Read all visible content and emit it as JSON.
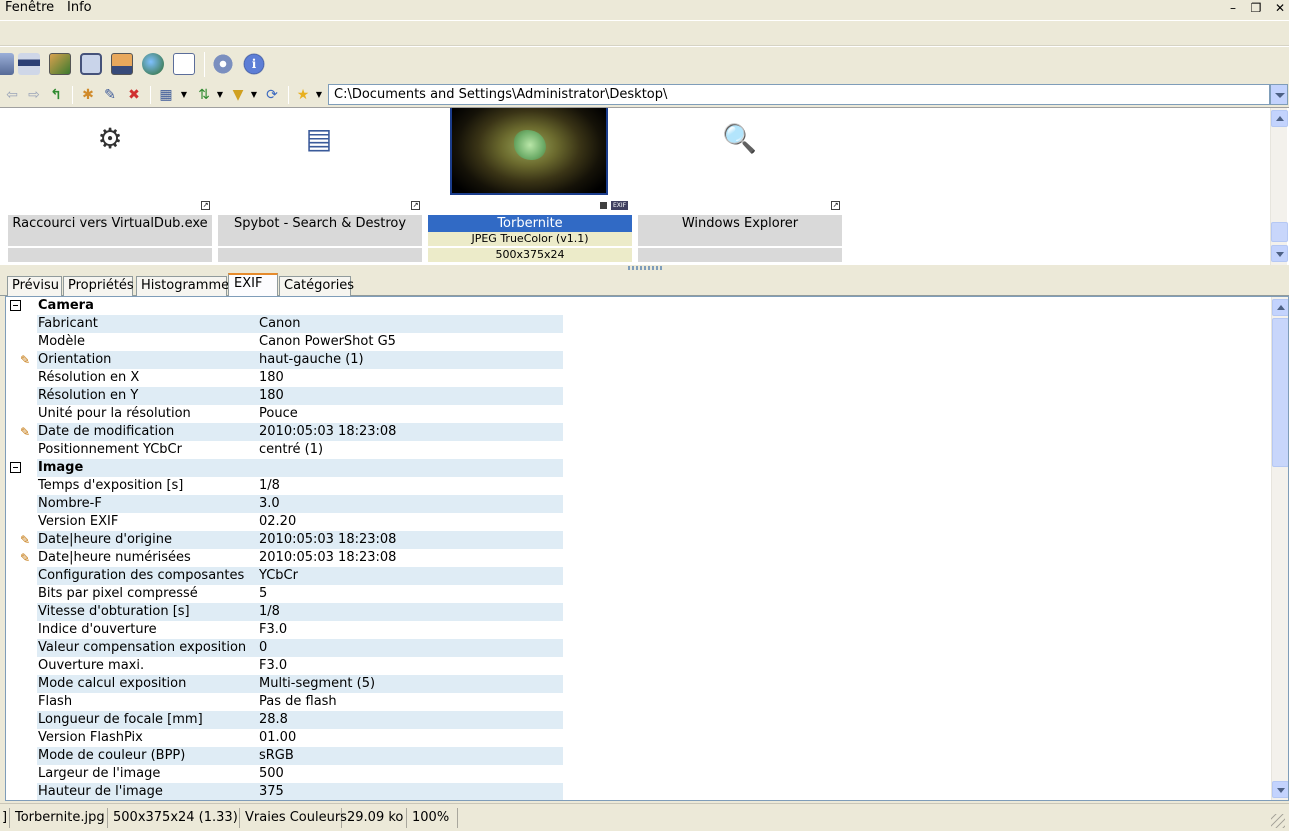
{
  "menu": {
    "items": [
      "Fenêtre",
      "Info"
    ]
  },
  "window_controls": {
    "minimize": "–",
    "restore": "❐",
    "close": "✕"
  },
  "toolbar": {
    "main_icons": [
      "print-icon",
      "scanner-icon",
      "slideshow-icon",
      "camera-icon",
      "desktop-icon",
      "web-icon",
      "batch-icon",
      "settings-icon",
      "info-icon"
    ],
    "nav_icons": [
      "back-icon",
      "forward-icon",
      "up-icon",
      "new-folder-icon",
      "rename-icon",
      "delete-icon",
      "view-mode-icon",
      "sort-icon",
      "filter-icon",
      "refresh-icon",
      "favorites-icon"
    ]
  },
  "address": {
    "path": "C:\\Documents and Settings\\Administrator\\Desktop\\"
  },
  "thumbnails": [
    {
      "name": "Raccourci vers VirtualDub.exe",
      "icon": "film-reel-icon",
      "shortcut": true,
      "line1": "",
      "line2": ""
    },
    {
      "name": "Spybot - Search & Destroy",
      "icon": "application-window-icon",
      "shortcut": true,
      "line1": "",
      "line2": ""
    },
    {
      "name": "Torbernite",
      "icon": "photo-thumbnail",
      "shortcut": false,
      "selected": true,
      "line1": "JPEG TrueColor (v1.1)",
      "line2": "500x375x24",
      "badge": "EXIF"
    },
    {
      "name": "Windows Explorer",
      "icon": "folder-search-icon",
      "shortcut": true,
      "line1": "",
      "line2": ""
    }
  ],
  "tabs": [
    {
      "label": "Prévisu"
    },
    {
      "label": "Propriétés"
    },
    {
      "label": "Histogramme"
    },
    {
      "label": "EXIF",
      "active": true
    },
    {
      "label": "Catégories"
    }
  ],
  "exif": [
    {
      "type": "category",
      "name": "Camera"
    },
    {
      "name": "Fabricant",
      "value": "Canon"
    },
    {
      "name": "Modèle",
      "value": "Canon PowerShot G5"
    },
    {
      "name": "Orientation",
      "value": "haut-gauche (1)",
      "editable": true
    },
    {
      "name": "Résolution en X",
      "value": "180"
    },
    {
      "name": "Résolution en Y",
      "value": "180"
    },
    {
      "name": "Unité pour la résolution",
      "value": "Pouce"
    },
    {
      "name": "Date de modification",
      "value": "2010:05:03 18:23:08",
      "editable": true
    },
    {
      "name": "Positionnement YCbCr",
      "value": "centré (1)"
    },
    {
      "type": "category",
      "name": "Image"
    },
    {
      "name": "Temps d'exposition [s]",
      "value": "1/8"
    },
    {
      "name": "Nombre-F",
      "value": "3.0"
    },
    {
      "name": "Version EXIF",
      "value": "02.20"
    },
    {
      "name": "Date|heure d'origine",
      "value": "2010:05:03 18:23:08",
      "editable": true
    },
    {
      "name": "Date|heure numérisées",
      "value": "2010:05:03 18:23:08",
      "editable": true
    },
    {
      "name": "Configuration des composantes",
      "value": "YCbCr"
    },
    {
      "name": "Bits par pixel compressé",
      "value": "5"
    },
    {
      "name": "Vitesse d'obturation [s]",
      "value": "1/8"
    },
    {
      "name": "Indice d'ouverture",
      "value": "F3.0"
    },
    {
      "name": "Valeur compensation exposition",
      "value": "0"
    },
    {
      "name": "Ouverture maxi.",
      "value": "F3.0"
    },
    {
      "name": "Mode calcul exposition",
      "value": "Multi-segment (5)"
    },
    {
      "name": "Flash",
      "value": "Pas de flash"
    },
    {
      "name": "Longueur de focale [mm]",
      "value": "28.8"
    },
    {
      "name": "Version FlashPix",
      "value": "01.00"
    },
    {
      "name": "Mode de couleur (BPP)",
      "value": "sRGB"
    },
    {
      "name": "Largeur de l'image",
      "value": "500"
    },
    {
      "name": "Hauteur de l'image",
      "value": "375"
    }
  ],
  "status": {
    "left": "]",
    "filename": "Torbernite.jpg",
    "dimensions": "500x375x24 (1.33)",
    "color_mode": "Vraies Couleurs",
    "file_size": "29.09 ko",
    "zoom": "100%"
  },
  "colors": {
    "selection": "#316ac5",
    "alt_row": "#dfecf5",
    "tab_highlight": "#e68b2c",
    "chrome": "#ece9d8"
  }
}
